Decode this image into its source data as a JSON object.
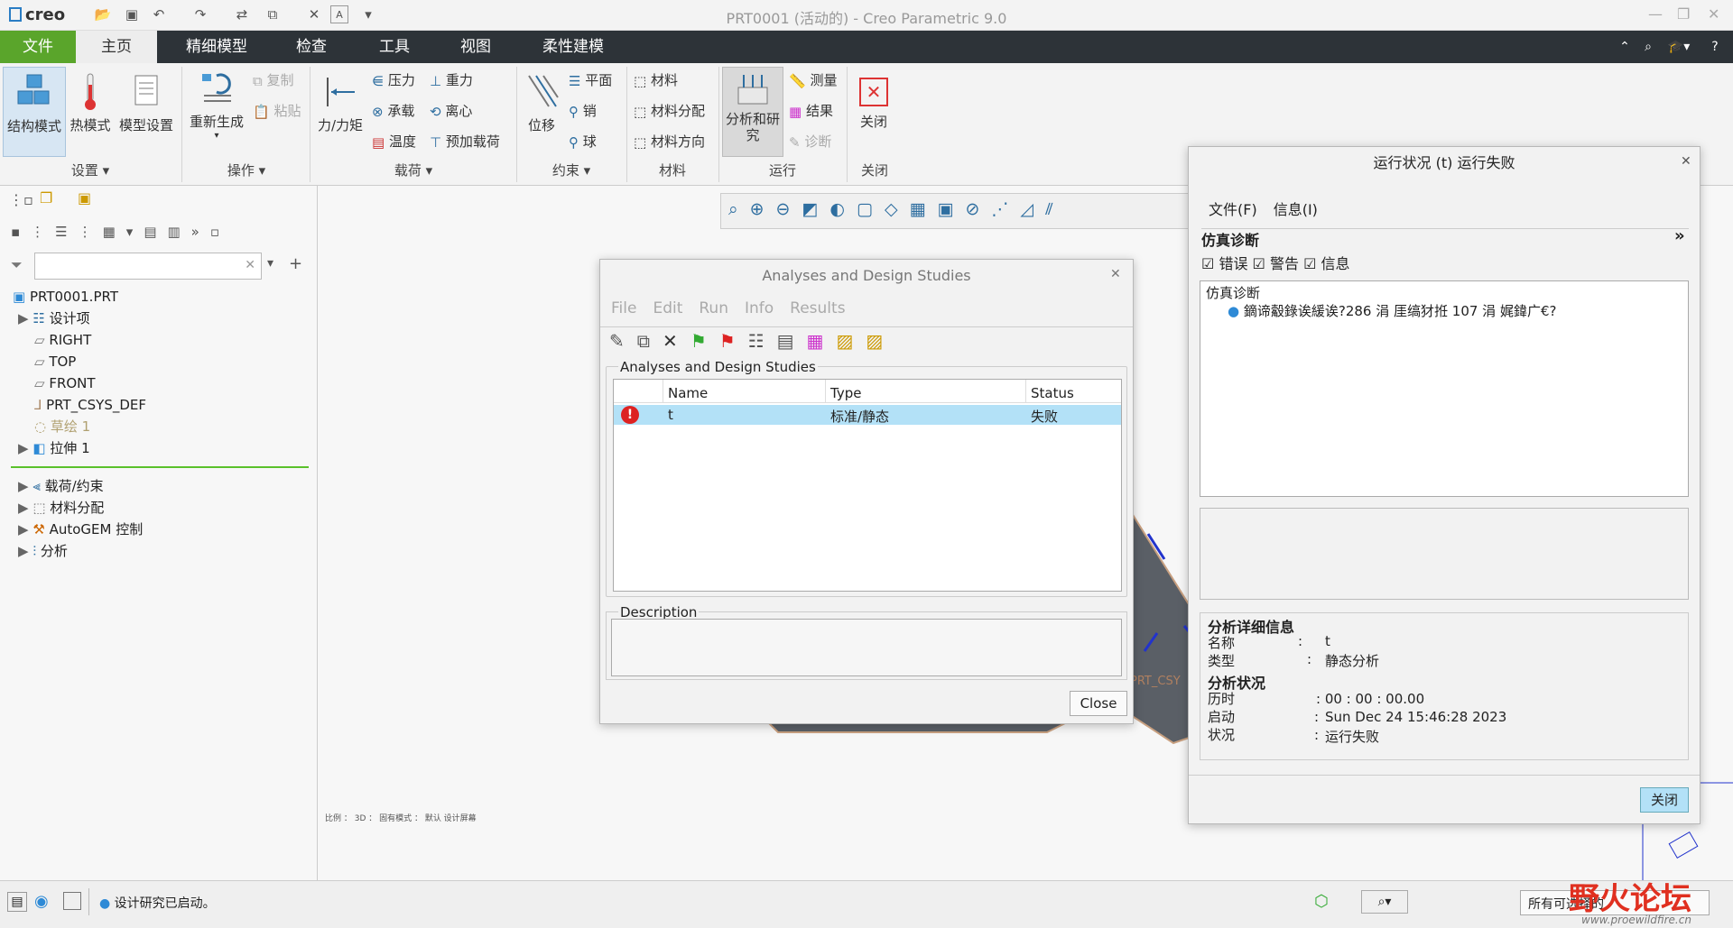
{
  "app": {
    "title": "PRT0001 (活动的) - Creo Parametric 9.0",
    "logo": "creo"
  },
  "ribbon_tabs": [
    "文件",
    "主页",
    "精细模型",
    "检查",
    "工具",
    "视图",
    "柔性建模"
  ],
  "groups": {
    "setup": "设置 ▾",
    "ops": "操作 ▾",
    "loads": "载荷 ▾",
    "cons": "约束 ▾",
    "mat": "材料",
    "run": "运行",
    "close": "关闭"
  },
  "buttons": {
    "struct": "结构模式",
    "thermal": "热模式",
    "modelset": "模型设置",
    "regen": "重新生成",
    "copy": "复制",
    "paste": "粘贴",
    "force": "力/力矩",
    "pressure": "压力",
    "gravity": "重力",
    "bearing": "承载",
    "centrifugal": "离心",
    "temp": "温度",
    "preload": "预加载荷",
    "disp": "位移",
    "plane": "平面",
    "pin": "销",
    "ball": "球",
    "material": "材料",
    "matassign": "材料分配",
    "matdir": "材料方向",
    "analysis": "分析和研究",
    "measure": "测量",
    "results": "结果",
    "diag": "诊断",
    "closebtn": "关闭"
  },
  "tree": {
    "root": "PRT0001.PRT",
    "items": [
      "设计项",
      "RIGHT",
      "TOP",
      "FRONT",
      "PRT_CSYS_DEF",
      "草绘 1",
      "拉伸 1"
    ],
    "sim": [
      "载荷/约束",
      "材料分配",
      "AutoGEM 控制",
      "分析"
    ]
  },
  "ads": {
    "title": "Analyses and Design Studies",
    "menu": [
      "File",
      "Edit",
      "Run",
      "Info",
      "Results"
    ],
    "group": "Analyses and Design Studies",
    "cols": [
      "Name",
      "Type",
      "Status"
    ],
    "row": {
      "name": "t",
      "type": "标准/静态",
      "status": "失败"
    },
    "desc": "Description",
    "close": "Close"
  },
  "run": {
    "title": "运行状况 (t) 运行失败",
    "menu": [
      "文件(F)",
      "信息(I)"
    ],
    "sec": "仿真诊断",
    "checks": [
      "错误",
      "警告",
      "信息"
    ],
    "tree_head": "仿真诊断",
    "msg": "鏑谛觳錄诶緩诶?286 涓   厓缟犲拰 107 涓   娓鍏广€?",
    "details_h": "分析详细信息",
    "name_l": "名称",
    "name_v": "t",
    "type_l": "类型",
    "type_v": "静态分析",
    "status_h": "分析状况",
    "elapsed_l": "历时",
    "elapsed_v": ": 00 : 00 : 00.00",
    "start_l": "启动",
    "start_v": "Sun Dec 24 15:46:28 2023",
    "state_l": "状况",
    "state_v": "运行失败",
    "close": "关闭"
  },
  "viewport": {
    "csys": "PRT_CSY",
    "bottomtext": "比例  ：  3D  ：  固有模式  ：  默认  设计屏幕"
  },
  "status": {
    "msg": "设计研究已启动。",
    "filter": "所有可选择的",
    "watermark": "野火论坛",
    "url": "www.proewildfire.cn"
  },
  "colors": {
    "accent": "#5aa52b",
    "select": "#b3e1f7",
    "tabbar": "#2d3338"
  }
}
